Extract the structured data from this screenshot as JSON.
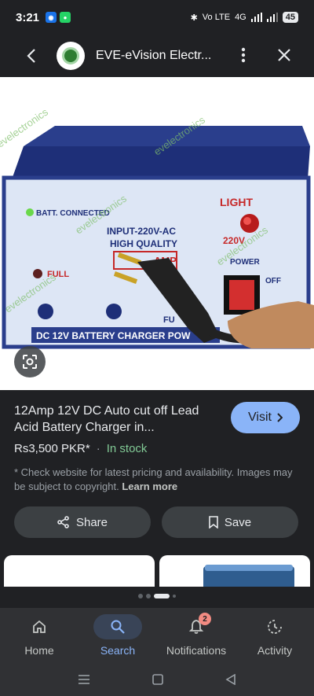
{
  "status_bar": {
    "time": "3:21",
    "signal_text": "Vo LTE",
    "network": "4G",
    "battery": "45"
  },
  "app_bar": {
    "site_title": "EVE-eVision Electr...",
    "icons": [
      "back-arrow-icon",
      "more-vert-icon",
      "close-icon"
    ]
  },
  "product_image": {
    "watermark": "evelectronics",
    "panel_labels": {
      "batt_connected": "BATT. CONNECTED",
      "light": "LIGHT",
      "input": "INPUT-220V-AC",
      "quality": "HIGH QUALITY",
      "amp": "AMP",
      "v220": "220V",
      "power": "POWER",
      "off": "OFF",
      "full": "FULL",
      "full2": "FU",
      "bottom_strip": "DC 12V BATTERY CHARGER POW"
    }
  },
  "product": {
    "title": "12Amp 12V DC Auto cut off Lead Acid Battery Charger in...",
    "visit_label": "Visit",
    "price": "Rs3,500 PKR*",
    "stock": "In stock",
    "disclaimer": "* Check website for latest pricing and availability. Images may be subject to copyright.",
    "learn_more": "Learn more"
  },
  "actions": {
    "share": "Share",
    "save": "Save"
  },
  "bottom_nav": {
    "items": [
      {
        "label": "Home",
        "icon": "home-icon"
      },
      {
        "label": "Search",
        "icon": "search-icon"
      },
      {
        "label": "Notifications",
        "icon": "bell-icon",
        "badge": "2"
      },
      {
        "label": "Activity",
        "icon": "activity-icon"
      }
    ],
    "active": "Search"
  },
  "colors": {
    "background": "#202124",
    "accent": "#8ab4f8",
    "stock_green": "#81c995",
    "badge": "#f28b82"
  }
}
